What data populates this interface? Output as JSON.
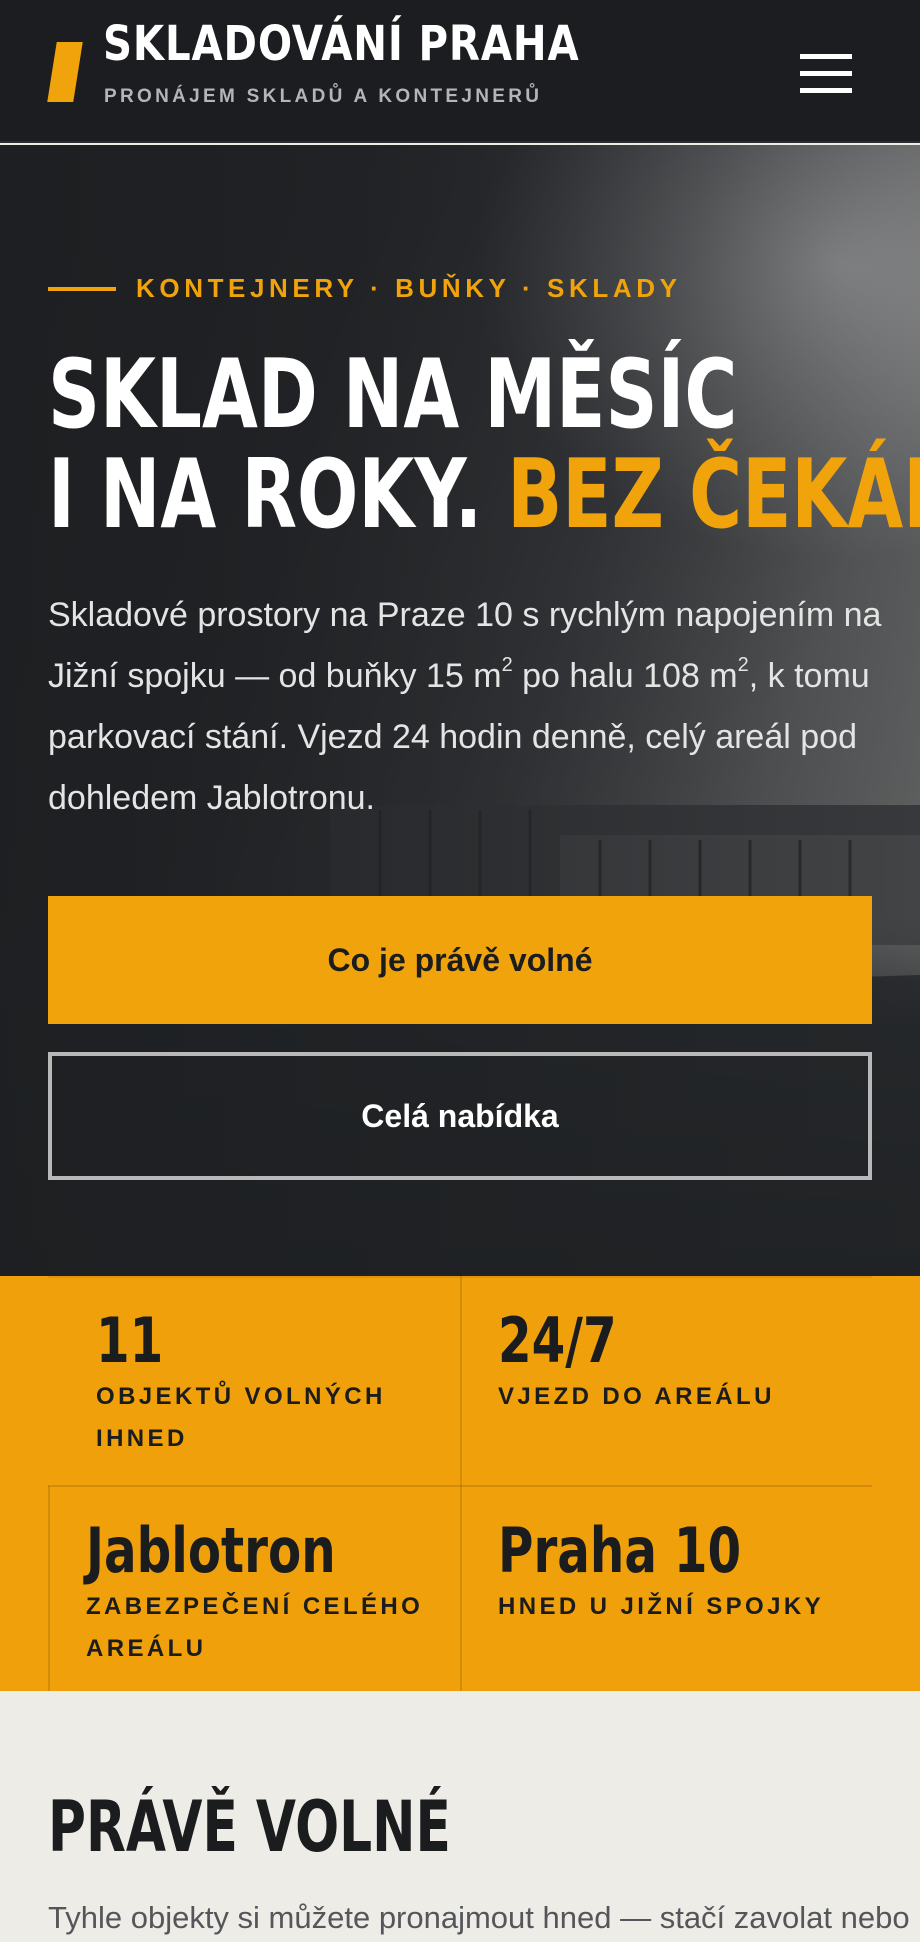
{
  "header": {
    "brand_title": "SKLADOVÁNÍ PRAHA",
    "brand_subtitle": "PRONÁJEM SKLADŮ A KONTEJNERŮ",
    "menu_icon": "hamburger-menu-icon"
  },
  "hero": {
    "eyebrow": "KONTEJNERY · BUŇKY · SKLADY",
    "title_line1": "SKLAD NA MĚSÍC",
    "title_line2_plain": "I NA ROKY.",
    "title_line2_accent": "BEZ ČEKÁNÍ.",
    "text_part1": "Skladové prostory na Praze 10 s rychlým napojením na Jižní spojku — od buňky 15 m",
    "text_sup1": "2",
    "text_part2": " po halu 108 m",
    "text_sup2": "2",
    "text_part3": ", k tomu parkovací stání. Vjezd 24 hodin denně, celý areál pod dohledem Jablotronu.",
    "primary_button": "Co je právě volné",
    "secondary_button": "Celá nabídka"
  },
  "stats": [
    {
      "value": "11",
      "label": "OBJEKTŮ VOLNÝCH IHNED"
    },
    {
      "value": "24/7",
      "label": "VJEZD DO AREÁLU"
    },
    {
      "value": "Jablotron",
      "label": "ZABEZPEČENÍ CELÉHO AREÁLU"
    },
    {
      "value": "Praha 10",
      "label": "HNED U JIŽNÍ SPOJKY"
    }
  ],
  "available": {
    "title": "PRÁVĚ VOLNÉ",
    "text": "Tyhle objekty si můžete pronajmout hned — stačí zavolat nebo"
  },
  "colors": {
    "accent": "#f0a30a",
    "header_bg": "#1c1d20",
    "page_bg": "#eeece7"
  }
}
